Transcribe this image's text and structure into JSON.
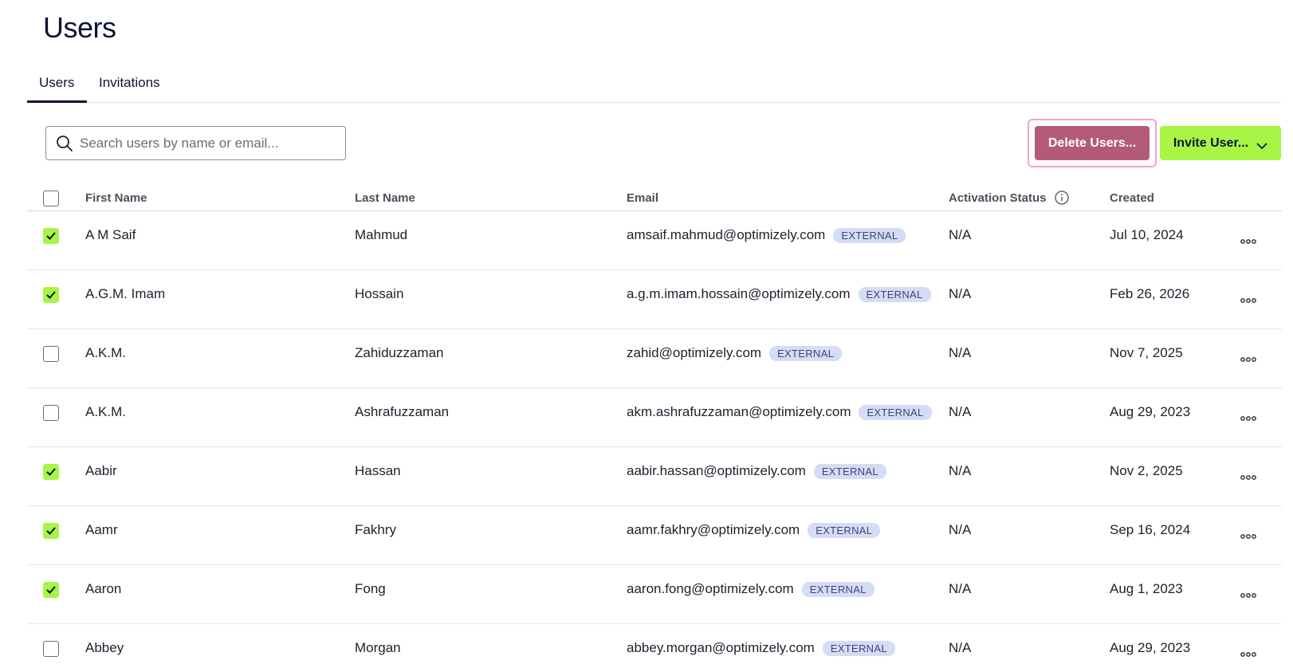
{
  "page": {
    "title": "Users"
  },
  "tabs": [
    {
      "label": "Users",
      "active": true
    },
    {
      "label": "Invitations",
      "active": false
    }
  ],
  "search": {
    "placeholder": "Search users by name or email..."
  },
  "actions": {
    "delete_label": "Delete Users...",
    "invite_label": "Invite User..."
  },
  "colors": {
    "accent_green": "#a8f545",
    "delete_pink": "#b35a7a",
    "badge_bg": "#d5dcf5",
    "title_navy": "#0e1433"
  },
  "table": {
    "headers": {
      "first": "First Name",
      "last": "Last Name",
      "email": "Email",
      "status": "Activation Status",
      "created": "Created"
    },
    "rows": [
      {
        "checked": true,
        "first": "A M Saif",
        "last": "Mahmud",
        "email": "amsaif.mahmud@optimizely.com",
        "badge": "EXTERNAL",
        "status": "N/A",
        "created": "Jul 10, 2024"
      },
      {
        "checked": true,
        "first": "A.G.M. Imam",
        "last": "Hossain",
        "email": "a.g.m.imam.hossain@optimizely.com",
        "badge": "EXTERNAL",
        "status": "N/A",
        "created": "Feb 26, 2026"
      },
      {
        "checked": false,
        "first": "A.K.M.",
        "last": "Zahiduzzaman",
        "email": "zahid@optimizely.com",
        "badge": "EXTERNAL",
        "status": "N/A",
        "created": "Nov 7, 2025"
      },
      {
        "checked": false,
        "first": "A.K.M.",
        "last": "Ashrafuzzaman",
        "email": "akm.ashrafuzzaman@optimizely.com",
        "badge": "EXTERNAL",
        "status": "N/A",
        "created": "Aug 29, 2023"
      },
      {
        "checked": true,
        "first": "Aabir",
        "last": "Hassan",
        "email": "aabir.hassan@optimizely.com",
        "badge": "EXTERNAL",
        "status": "N/A",
        "created": "Nov 2, 2025"
      },
      {
        "checked": true,
        "first": "Aamr",
        "last": "Fakhry",
        "email": "aamr.fakhry@optimizely.com",
        "badge": "EXTERNAL",
        "status": "N/A",
        "created": "Sep 16, 2024"
      },
      {
        "checked": true,
        "first": "Aaron",
        "last": "Fong",
        "email": "aaron.fong@optimizely.com",
        "badge": "EXTERNAL",
        "status": "N/A",
        "created": "Aug 1, 2023"
      },
      {
        "checked": false,
        "first": "Abbey",
        "last": "Morgan",
        "email": "abbey.morgan@optimizely.com",
        "badge": "EXTERNAL",
        "status": "N/A",
        "created": "Aug 29, 2023"
      }
    ]
  },
  "icons": {
    "search": "search-icon",
    "chevron": "chevron-down-icon",
    "info": "info-icon",
    "more": "more-options-icon",
    "check": "checkmark-icon"
  }
}
